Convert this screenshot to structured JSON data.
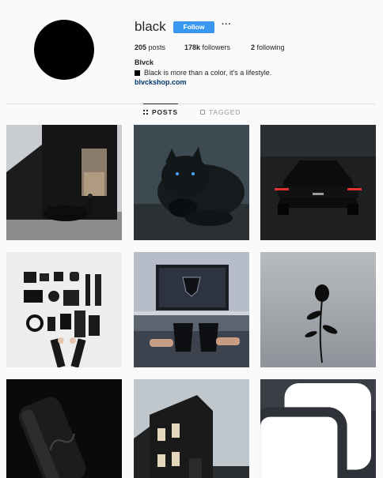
{
  "profile": {
    "username": "black",
    "follow_label": "Follow",
    "more_label": "···",
    "stats": {
      "posts_count": "205",
      "posts_label": "posts",
      "followers_count": "178k",
      "followers_label": "followers",
      "following_count": "2",
      "following_label": "following"
    },
    "full_name": "Blvck",
    "bio": "Black is more than a color, it's a lifestyle.",
    "link": "blvckshop.com"
  },
  "tabs": [
    {
      "label": "POSTS",
      "icon": "grid-icon",
      "active": true
    },
    {
      "label": "TAGGED",
      "icon": "tag-icon",
      "active": false
    }
  ],
  "colors": {
    "follow_button": "#3897f0",
    "background": "#fafafa",
    "text": "#262626",
    "link": "#003569"
  },
  "posts": [
    {
      "subject": "black-house-with-car"
    },
    {
      "subject": "black-panther"
    },
    {
      "subject": "black-lamborghini"
    },
    {
      "subject": "black-flatlay-items"
    },
    {
      "subject": "black-coffee-cups-warner-bros"
    },
    {
      "subject": "black-rose"
    },
    {
      "subject": "black-coca-cola-can"
    },
    {
      "subject": "black-building"
    },
    {
      "subject": "black-hot-air-balloon",
      "multiple": true
    }
  ]
}
